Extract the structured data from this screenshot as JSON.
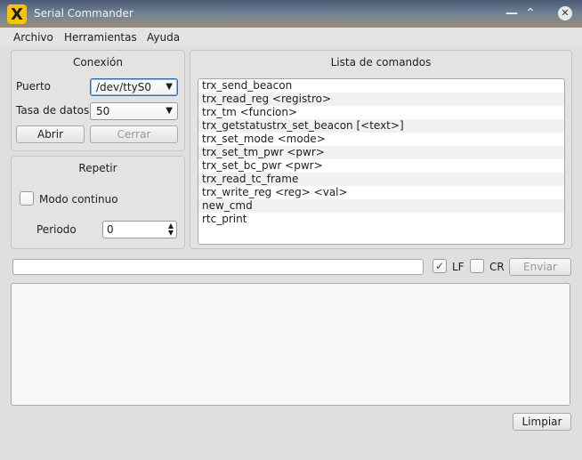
{
  "window": {
    "title": "Serial Commander",
    "logo_glyph": "X",
    "minimize_glyph": "—",
    "maximize_glyph": "⌃",
    "close_glyph": "✕"
  },
  "menu": [
    "Archivo",
    "Herramientas",
    "Ayuda"
  ],
  "conexion": {
    "title": "Conexión",
    "puerto_label": "Puerto",
    "puerto_value": "/dev/ttyS0",
    "tasa_label": "Tasa de datos",
    "tasa_value": "50",
    "abrir_label": "Abrir",
    "cerrar_label": "Cerrar"
  },
  "repetir": {
    "title": "Repetir",
    "modo_label": "Modo continuo",
    "periodo_label": "Periodo",
    "periodo_value": "0"
  },
  "comandos": {
    "title": "Lista de comandos",
    "items": [
      "trx_send_beacon",
      "trx_read_reg <registro>",
      "trx_tm <funcion>",
      "trx_getstatustrx_set_beacon [<text>]",
      "trx_set_mode <mode>",
      "trx_set_tm_pwr <pwr>",
      "trx_set_bc_pwr <pwr>",
      "trx_read_tc_frame",
      "trx_write_reg <reg> <val>",
      "new_cmd",
      "rtc_print"
    ]
  },
  "send": {
    "input_value": "",
    "lf_label": "LF",
    "lf_checked": true,
    "cr_label": "CR",
    "cr_checked": false,
    "enviar_label": "Enviar"
  },
  "output": {
    "text": "",
    "limpiar_label": "Limpiar"
  },
  "colors": {
    "accent": "#3a6aa8",
    "logo": "#f6c400"
  }
}
